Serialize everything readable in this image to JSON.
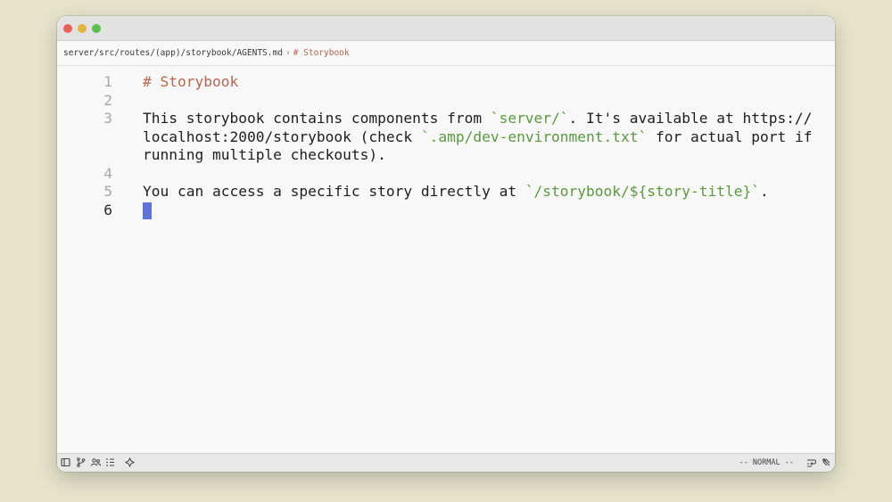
{
  "window": {
    "traffic_lights": {
      "close": "#ec5f57",
      "minimize": "#e5b43a",
      "zoom": "#5bbf4b"
    }
  },
  "breadcrumb": {
    "path": "server/src/routes/(app)/storybook/AGENTS.md",
    "separator": "›",
    "heading": "# Storybook"
  },
  "editor": {
    "lines": [
      {
        "number": "1",
        "parts": [
          "# Storybook"
        ]
      },
      {
        "number": "2",
        "parts": []
      },
      {
        "number": "3",
        "parts": [
          "This storybook contains components from ",
          "`server/`",
          ". It's available at https://localhost:2000/storybook (check ",
          "`.amp/dev-environment.txt`",
          " for actual port if running multiple checkouts)."
        ]
      },
      {
        "number": "4",
        "parts": []
      },
      {
        "number": "5",
        "parts": [
          "You can access a specific story directly at ",
          "`/storybook/${story-title}`",
          "."
        ]
      },
      {
        "number": "6",
        "parts": []
      }
    ],
    "current_line": "6"
  },
  "statusbar": {
    "mode": "-- NORMAL --",
    "left_icons": [
      "sidebar-toggle-icon",
      "git-branch-icon",
      "collaborators-icon",
      "outline-icon",
      "ai-assistant-icon"
    ],
    "right_icons": [
      "line-wrap-icon",
      "settings-icon"
    ]
  },
  "colors": {
    "heading": "#b8664f",
    "code_string": "#5a9a3f",
    "cursor": "#5f73d8",
    "background": "#e6e5cb"
  }
}
